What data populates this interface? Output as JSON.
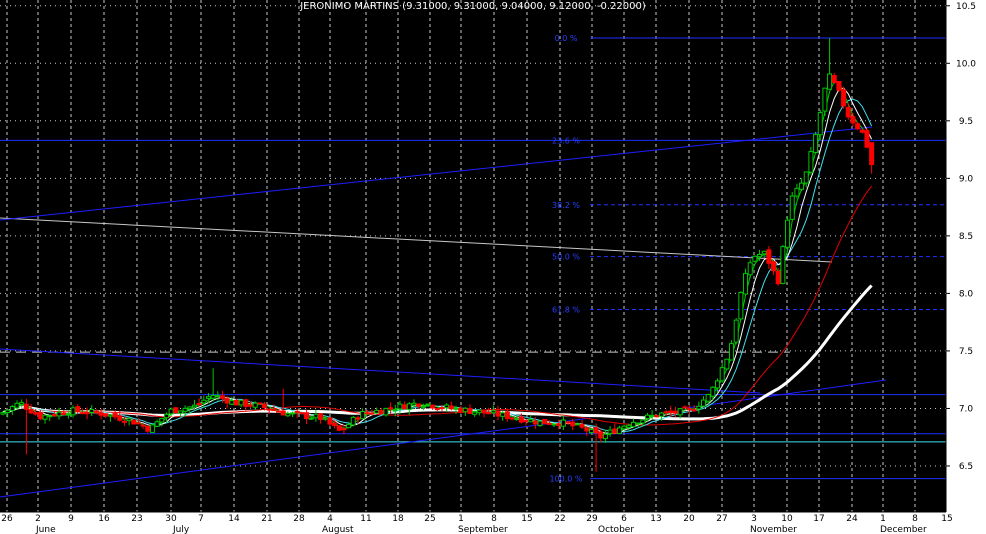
{
  "header": {
    "title": "JERONIMO MARTINS (9.31000, 9.31000, 9.04000, 9.12000, -0.22000)"
  },
  "chart_data": {
    "type": "candlestick",
    "title": "JERONIMO MARTINS (9.31000, 9.31000, 9.04000, 9.12000, -0.22000)",
    "symbol": "JERONIMO MARTINS",
    "last_bar": {
      "open": 9.31,
      "high": 9.31,
      "low": 9.04,
      "close": 9.12,
      "change": -0.22
    },
    "ylim": [
      6.1,
      10.55
    ],
    "y_ticks": [
      "6.5",
      "7.0",
      "7.5",
      "8.0",
      "8.5",
      "9.0",
      "9.5",
      "10.0",
      "10.5"
    ],
    "x_day_ticks": [
      "26",
      "2",
      "9",
      "16",
      "23",
      "30",
      "7",
      "14",
      "21",
      "28",
      "4",
      "11",
      "18",
      "25",
      "1",
      "8",
      "15",
      "22",
      "29",
      "6",
      "13",
      "20",
      "27",
      "3",
      "10",
      "17",
      "24",
      "1",
      "8",
      "15"
    ],
    "x_months": [
      "June",
      "July",
      "August",
      "September",
      "October",
      "November",
      "December"
    ],
    "fibonacci": [
      {
        "label": "0.0 %",
        "value": 10.22
      },
      {
        "label": "23.6 %",
        "value": 9.33
      },
      {
        "label": "38.2 %",
        "value": 8.77
      },
      {
        "label": "50.0 %",
        "value": 8.32
      },
      {
        "label": "61.8 %",
        "value": 7.86
      },
      {
        "label": "100.0 %",
        "value": 6.39
      }
    ],
    "colors": {
      "background": "#000000",
      "grid": "#c8c8c8",
      "up_candle": "#00c800",
      "down_candle": "#ff0000",
      "ma_short": "#ffffff",
      "ma_cyan": "#40e0f0",
      "ma_red": "#e00000",
      "ma_long": "#ffffff",
      "trend_lines": "#1e1eff",
      "fib_labels": "#2840ff"
    }
  }
}
